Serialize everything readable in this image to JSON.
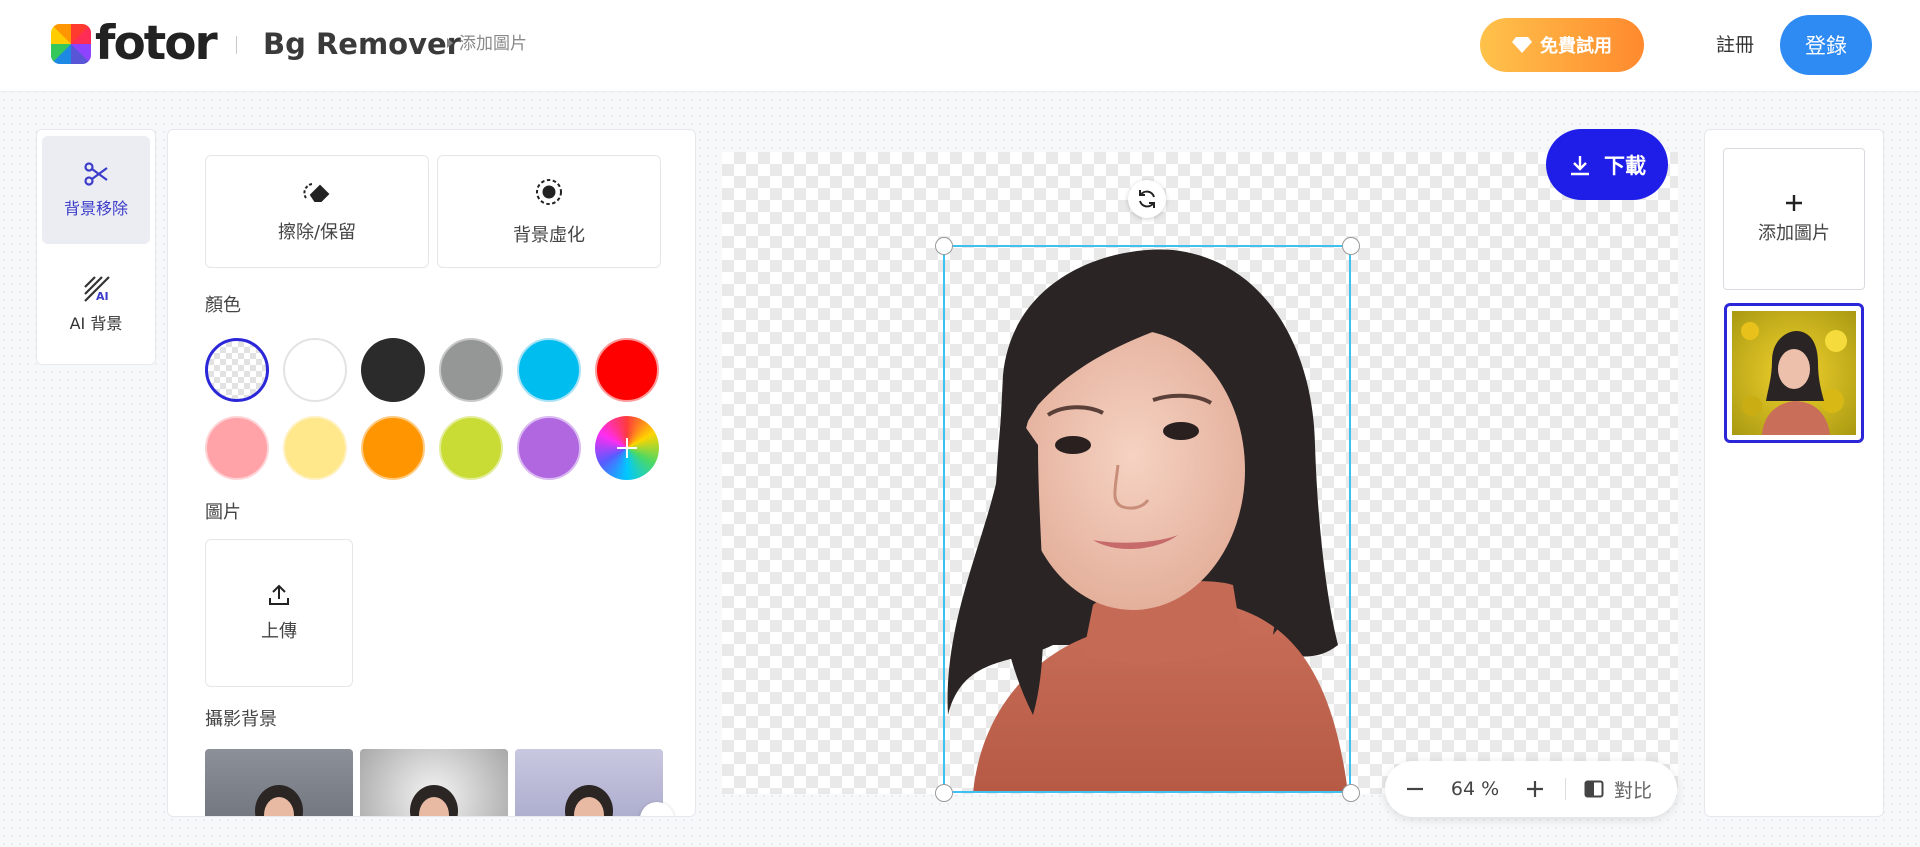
{
  "header": {
    "brand": "fotor",
    "app_title": "Bg Remover",
    "breadcrumb": "添加圖片",
    "trial_label": "免費試用",
    "register_label": "註冊",
    "login_label": "登錄"
  },
  "rail": {
    "items": [
      {
        "label": "背景移除",
        "icon": "scissors-icon",
        "active": true
      },
      {
        "label": "AI 背景",
        "icon": "ai-background-icon",
        "active": false
      }
    ]
  },
  "panel": {
    "options": [
      {
        "label": "擦除/保留",
        "icon": "eraser-icon"
      },
      {
        "label": "背景虛化",
        "icon": "blur-icon"
      }
    ],
    "color_section": "顏色",
    "colors": [
      "transparent",
      "#ffffff",
      "#2b2b2b",
      "#959797",
      "#00bdef",
      "#ff0000",
      "#ffa3a8",
      "#ffe88b",
      "#ff9500",
      "#c9dc35",
      "#b067e0",
      "custom"
    ],
    "selected_color": "transparent",
    "image_section": "圖片",
    "upload_label": "上傳",
    "photo_section": "攝影背景"
  },
  "canvas": {
    "download_label": "下載",
    "zoom_value": "64 %",
    "compare_label": "對比"
  },
  "right_panel": {
    "add_image_label": "添加圖片"
  },
  "colors": {
    "accent": "#2b26d8",
    "selection": "#3fc1ef",
    "login_blue": "#2f8bf4",
    "download_blue": "#1f1de8"
  }
}
